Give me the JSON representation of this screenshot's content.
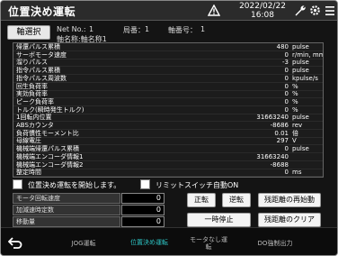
{
  "header": {
    "title": "位置決め運転",
    "date": "2022/02/22",
    "time": "16:08",
    "icons": [
      "warning-icon",
      "wrench-icon",
      "gear-icon",
      "menu-icon"
    ]
  },
  "axis": {
    "button_label": "軸選択",
    "net_no_label": "Net No.:",
    "net_no": "1",
    "station_label": "局番：",
    "station": "1",
    "axis_no_label": "軸番号：",
    "axis_no": "1",
    "axis_name": "軸名称:軸名称1"
  },
  "monitor_rows": [
    {
      "label": "帰還パルス累積",
      "value": "480",
      "unit": "pulse"
    },
    {
      "label": "サーボモータ速度",
      "value": "0",
      "unit": "r/min, mm/s"
    },
    {
      "label": "溜りパルス",
      "value": "-3",
      "unit": "pulse"
    },
    {
      "label": "指令パルス累積",
      "value": "0",
      "unit": "pulse"
    },
    {
      "label": "指令パルス周波数",
      "value": "0",
      "unit": "kpulse/s"
    },
    {
      "label": "回生負荷率",
      "value": "0",
      "unit": "%"
    },
    {
      "label": "実効負荷率",
      "value": "0",
      "unit": "%"
    },
    {
      "label": "ピーク負荷率",
      "value": "0",
      "unit": "%"
    },
    {
      "label": "トルク(瞬時発生トルク)",
      "value": "0",
      "unit": "%"
    },
    {
      "label": "1回転内位置",
      "value": "31663240",
      "unit": "pulse"
    },
    {
      "label": "ABSカウンタ",
      "value": "-8686",
      "unit": "rev"
    },
    {
      "label": "負荷慣性モーメント比",
      "value": "0.01",
      "unit": "倍"
    },
    {
      "label": "母線電圧",
      "value": "297",
      "unit": "V"
    },
    {
      "label": "機械端帰還パルス累積",
      "value": "0",
      "unit": "pulse"
    },
    {
      "label": "機械端エンコーダ情報1",
      "value": "31663240",
      "unit": ""
    },
    {
      "label": "機械端エンコーダ情報2",
      "value": "-8688",
      "unit": ""
    },
    {
      "label": "整定時間",
      "value": "0",
      "unit": "ms"
    }
  ],
  "checkboxes": {
    "start_label": "位置決め運転を開始します。",
    "limit_label": "リミットスイッチ自動ON"
  },
  "fields": [
    {
      "label": "モータ回転速度",
      "value": "0"
    },
    {
      "label": "加減速時定数",
      "value": "0"
    },
    {
      "label": "移動量",
      "value": "0"
    }
  ],
  "buttons": {
    "forward": "正転",
    "reverse": "逆転",
    "restart": "残距離の再始動",
    "pause": "一時停止",
    "clear": "残距離のクリア"
  },
  "tabs": [
    "JOG運転",
    "位置決め運転",
    "モータなし運転",
    "DO強制出力"
  ],
  "colors": {
    "active_tab": "#2ec6c6",
    "background": "#141414"
  }
}
